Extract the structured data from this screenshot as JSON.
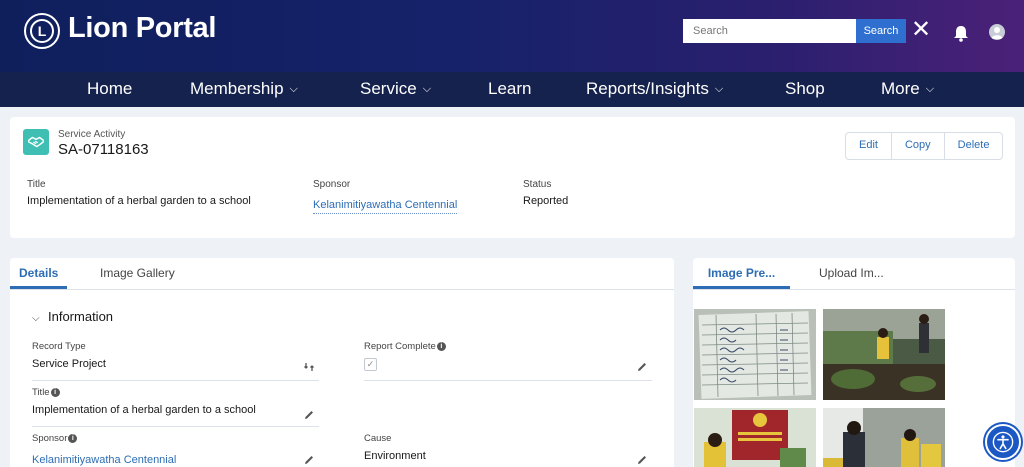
{
  "header": {
    "brand": "Lion Portal",
    "logo_text": "LIONS",
    "search_placeholder": "Search",
    "search_button": "Search",
    "colors": {
      "gradient_start": "#0f1f5c",
      "gradient_end": "#4b2178",
      "search_button": "#2f6fd0"
    }
  },
  "nav": {
    "items": [
      {
        "label": "Home",
        "dropdown": false
      },
      {
        "label": "Membership",
        "dropdown": true
      },
      {
        "label": "Service",
        "dropdown": true
      },
      {
        "label": "Learn",
        "dropdown": false
      },
      {
        "label": "Reports/Insights",
        "dropdown": true
      },
      {
        "label": "Shop",
        "dropdown": false
      },
      {
        "label": "More",
        "dropdown": true
      }
    ]
  },
  "record": {
    "type": "Service Activity",
    "id": "SA-07118163",
    "actions": [
      "Edit",
      "Copy",
      "Delete"
    ],
    "highlights": {
      "title_label": "Title",
      "title_value": "Implementation of a herbal garden to a school",
      "sponsor_label": "Sponsor",
      "sponsor_value": "Kelanimitiyawatha Centennial",
      "status_label": "Status",
      "status_value": "Reported"
    }
  },
  "details": {
    "tabs": [
      "Details",
      "Image Gallery"
    ],
    "section": "Information",
    "fields": {
      "record_type_label": "Record Type",
      "record_type_value": "Service Project",
      "report_complete_label": "Report Complete",
      "report_complete_checked": true,
      "title_label": "Title",
      "title_value": "Implementation of a herbal garden to a school",
      "sponsor_label": "Sponsor",
      "sponsor_value": "Kelanimitiyawatha Centennial",
      "cause_label": "Cause",
      "cause_value": "Environment"
    }
  },
  "gallery": {
    "tabs": [
      "Image Pre...",
      "Upload Im..."
    ],
    "images": [
      "handwritten-attendance-sheet",
      "volunteer-planting-garden",
      "lions-club-banner-ceremony",
      "volunteers-at-garden"
    ]
  },
  "icons": {
    "record_icon": "handshake-icon",
    "close": "close-icon",
    "bell": "bell-icon",
    "avatar": "avatar-icon",
    "accessibility": "accessibility-icon"
  }
}
